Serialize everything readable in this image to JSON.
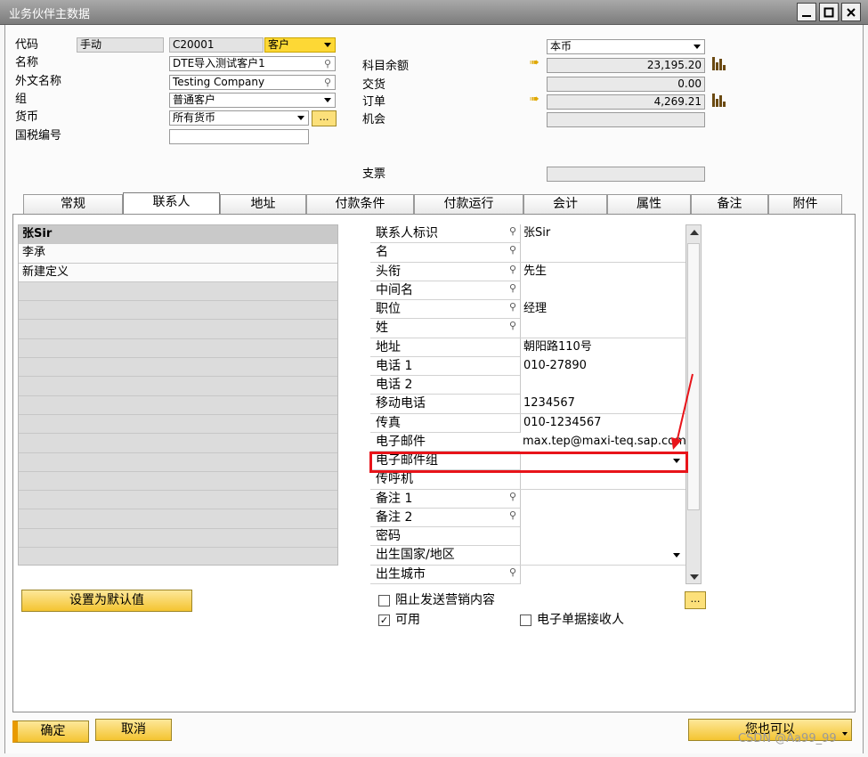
{
  "window": {
    "title": "业务伙伴主数据"
  },
  "header": {
    "code_label": "代码",
    "code_mode": "手动",
    "code_value": "C20001",
    "type_value": "客户",
    "name_label": "名称",
    "name_value": "DTE导入测试客户1",
    "foreign_name_label": "外文名称",
    "foreign_name_value": "Testing Company",
    "group_label": "组",
    "group_value": "普通客户",
    "currency_label": "货币",
    "currency_value": "所有货币",
    "tax_label": "国税编号",
    "tax_value": "",
    "currency_select": "本币",
    "balance_label": "科目余额",
    "balance_value": "23,195.20",
    "delivery_label": "交货",
    "delivery_value": "0.00",
    "order_label": "订单",
    "order_value": "4,269.21",
    "opportunity_label": "机会",
    "opportunity_value": "",
    "check_label": "支票",
    "check_value": ""
  },
  "tabs": [
    "常规",
    "联系人",
    "地址",
    "付款条件",
    "付款运行",
    "会计",
    "属性",
    "备注",
    "附件"
  ],
  "contacts": [
    "张Sir",
    "李承",
    "新建定义"
  ],
  "set_default_label": "设置为默认值",
  "fields": [
    {
      "label": "联系人标识",
      "value": "张Sir"
    },
    {
      "label": "名",
      "value": ""
    },
    {
      "label": "头衔",
      "value": "先生"
    },
    {
      "label": "中间名",
      "value": ""
    },
    {
      "label": "职位",
      "value": "经理"
    },
    {
      "label": "姓",
      "value": ""
    },
    {
      "label": "地址",
      "value": "朝阳路110号"
    },
    {
      "label": "电话 1",
      "value": "010-27890"
    },
    {
      "label": "电话 2",
      "value": ""
    },
    {
      "label": "移动电话",
      "value": "1234567"
    },
    {
      "label": "传真",
      "value": "010-1234567"
    },
    {
      "label": "电子邮件",
      "value": "max.tep@maxi-teq.sap.com"
    },
    {
      "label": "电子邮件组",
      "value": ""
    },
    {
      "label": "传呼机",
      "value": ""
    },
    {
      "label": "备注 1",
      "value": ""
    },
    {
      "label": "备注 2",
      "value": ""
    },
    {
      "label": "密码",
      "value": ""
    },
    {
      "label": "出生国家/地区",
      "value": ""
    },
    {
      "label": "出生城市",
      "value": ""
    }
  ],
  "checkboxes": {
    "block_marketing": "阻止发送营销内容",
    "active": "可用",
    "e_doc_recipient": "电子单据接收人"
  },
  "footer": {
    "ok": "确定",
    "cancel": "取消",
    "you_can_also": "您也可以"
  },
  "watermark": "CSDN @Aa99_99",
  "colors": {
    "accent_yellow": "#fdd835",
    "highlight_red": "#e8141a"
  }
}
